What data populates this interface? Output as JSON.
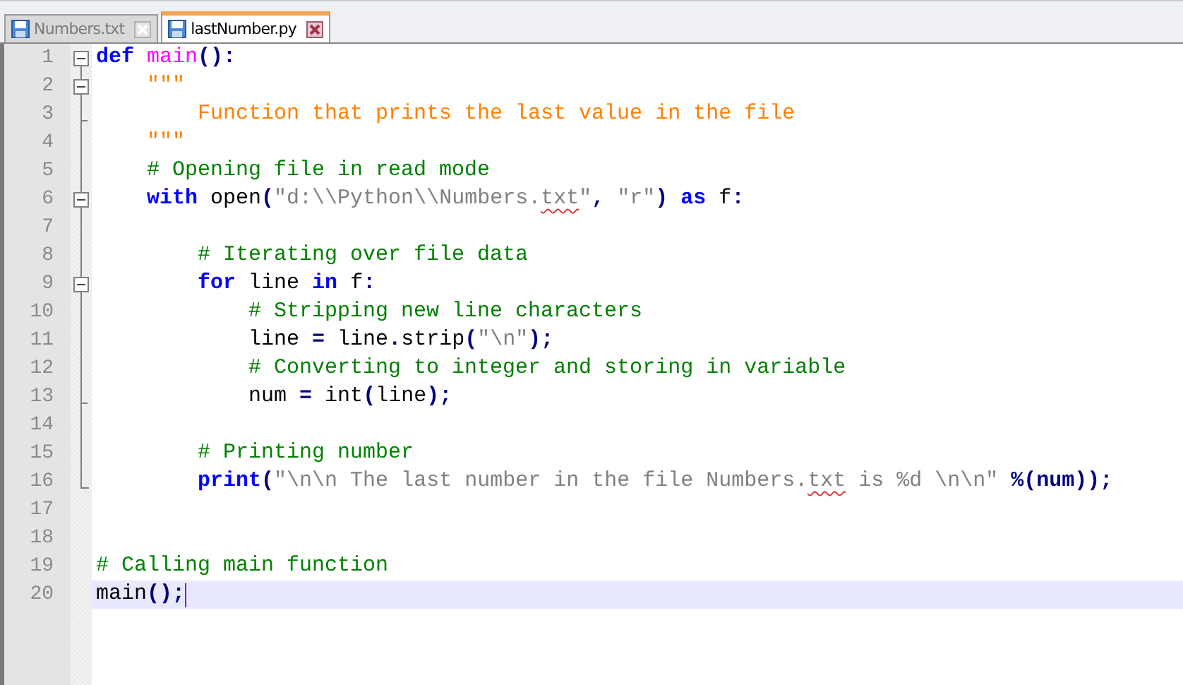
{
  "tabs": [
    {
      "label": "Numbers.txt",
      "selected": false
    },
    {
      "label": "lastNumber.py",
      "selected": true
    }
  ],
  "editor": {
    "lines": [
      {
        "number": "1",
        "fold": {
          "kind": "box"
        },
        "current": false,
        "tokens": [
          {
            "kind": "keyword",
            "text": "def"
          },
          {
            "kind": "defname",
            "text": " main"
          },
          {
            "kind": "operator",
            "text": "():"
          }
        ]
      },
      {
        "number": "2",
        "fold": {
          "kind": "box"
        },
        "current": false,
        "tokens": [
          {
            "kind": "docstring",
            "text": "    \"\"\""
          }
        ]
      },
      {
        "number": "3",
        "fold": {
          "kind": "tick"
        },
        "current": false,
        "tokens": [
          {
            "kind": "docstring",
            "text": "        Function that prints the last value in the file"
          }
        ]
      },
      {
        "number": "4",
        "current": false,
        "tokens": [
          {
            "kind": "docstring",
            "text": "    \"\"\""
          }
        ]
      },
      {
        "number": "5",
        "current": false,
        "tokens": [
          {
            "kind": "comment",
            "text": "    # Opening file in read mode"
          }
        ]
      },
      {
        "number": "6",
        "fold": {
          "kind": "box"
        },
        "current": false,
        "tokens": [
          {
            "kind": "keyword",
            "text": "    with"
          },
          {
            "kind": "plain",
            "text": " open"
          },
          {
            "kind": "operator",
            "text": "("
          },
          {
            "kind": "string",
            "text": "\"d:\\\\Python\\\\Numbers."
          },
          {
            "kind": "string",
            "text": "txt",
            "misspelled": true
          },
          {
            "kind": "string",
            "text": "\""
          },
          {
            "kind": "operator",
            "text": ","
          },
          {
            "kind": "string",
            "text": " \"r\""
          },
          {
            "kind": "operator",
            "text": ")"
          },
          {
            "kind": "keyword",
            "text": " as"
          },
          {
            "kind": "plain",
            "text": " f"
          },
          {
            "kind": "operator",
            "text": ":"
          }
        ]
      },
      {
        "number": "7",
        "current": false
      },
      {
        "number": "8",
        "current": false,
        "tokens": [
          {
            "kind": "comment",
            "text": "        # Iterating over file data"
          }
        ]
      },
      {
        "number": "9",
        "fold": {
          "kind": "box"
        },
        "current": false,
        "tokens": [
          {
            "kind": "keyword",
            "text": "        for"
          },
          {
            "kind": "plain",
            "text": " line "
          },
          {
            "kind": "keyword",
            "text": "in"
          },
          {
            "kind": "plain",
            "text": " f"
          },
          {
            "kind": "operator",
            "text": ":"
          }
        ]
      },
      {
        "number": "10",
        "current": false,
        "tokens": [
          {
            "kind": "comment",
            "text": "            # Stripping new line characters"
          }
        ]
      },
      {
        "number": "11",
        "current": false,
        "tokens": [
          {
            "kind": "plain",
            "text": "            line "
          },
          {
            "kind": "operator",
            "text": "="
          },
          {
            "kind": "plain",
            "text": " line"
          },
          {
            "kind": "operator",
            "text": "."
          },
          {
            "kind": "plain",
            "text": "strip"
          },
          {
            "kind": "operator",
            "text": "("
          },
          {
            "kind": "string",
            "text": "\"\\n\""
          },
          {
            "kind": "operator",
            "text": ");"
          }
        ]
      },
      {
        "number": "12",
        "current": false,
        "tokens": [
          {
            "kind": "comment",
            "text": "            # Converting to integer and storing in variable"
          }
        ]
      },
      {
        "number": "13",
        "fold": {
          "kind": "tick"
        },
        "current": false,
        "tokens": [
          {
            "kind": "plain",
            "text": "            num "
          },
          {
            "kind": "operator",
            "text": "="
          },
          {
            "kind": "plain",
            "text": " int"
          },
          {
            "kind": "operator",
            "text": "("
          },
          {
            "kind": "plain",
            "text": "line"
          },
          {
            "kind": "operator",
            "text": ");"
          }
        ]
      },
      {
        "number": "14",
        "current": false
      },
      {
        "number": "15",
        "current": false,
        "tokens": [
          {
            "kind": "comment",
            "text": "        # Printing number"
          }
        ]
      },
      {
        "number": "16",
        "fold": {
          "kind": "corner"
        },
        "current": false,
        "tokens": [
          {
            "kind": "keyword",
            "text": "        print"
          },
          {
            "kind": "operator",
            "text": "("
          },
          {
            "kind": "string",
            "text": "\"\\n\\n The last number in the file Numbers."
          },
          {
            "kind": "string",
            "text": "txt",
            "misspelled": true
          },
          {
            "kind": "string",
            "text": " is %d \\n\\n\""
          },
          {
            "kind": "operator",
            "text": " %(num));"
          }
        ]
      },
      {
        "number": "17",
        "current": false
      },
      {
        "number": "18",
        "current": false
      },
      {
        "number": "19",
        "current": false,
        "tokens": [
          {
            "kind": "comment",
            "text": "# Calling main function"
          }
        ]
      },
      {
        "number": "20",
        "current": true,
        "tokens": [
          {
            "kind": "plain",
            "text": "main"
          },
          {
            "kind": "operator",
            "text": "();"
          }
        ]
      }
    ]
  }
}
